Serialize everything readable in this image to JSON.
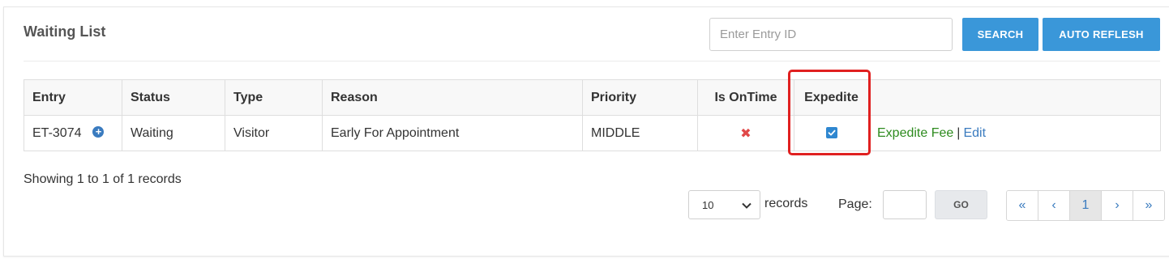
{
  "header": {
    "title": "Waiting List",
    "search_placeholder": "Enter Entry ID",
    "search_label": "SEARCH",
    "auto_refresh_label": "AUTO REFLESH"
  },
  "table": {
    "columns": [
      "Entry",
      "Status",
      "Type",
      "Reason",
      "Priority",
      "Is OnTime",
      "Expedite",
      ""
    ],
    "rows": [
      {
        "entry": "ET-3074",
        "status": "Waiting",
        "type": "Visitor",
        "reason": "Early For Appointment",
        "priority": "MIDDLE",
        "is_ontime_icon": "x-icon",
        "expedite_checked": true,
        "actions": {
          "expedite_fee": "Expedite Fee",
          "separator": "|",
          "edit": "Edit"
        }
      }
    ]
  },
  "footer": {
    "summary": "Showing 1 to 1 of 1 records",
    "page_size": "10",
    "records_label": "records",
    "page_label": "Page:",
    "go_label": "GO",
    "pager": {
      "first": "«",
      "prev": "‹",
      "current": "1",
      "next": "›",
      "last": "»"
    }
  },
  "colors": {
    "primary_button": "#3a97d9",
    "highlight": "#e02020",
    "link_green": "#2e8b1f",
    "link_blue": "#3a7bbf",
    "cross_red": "#e04848"
  }
}
